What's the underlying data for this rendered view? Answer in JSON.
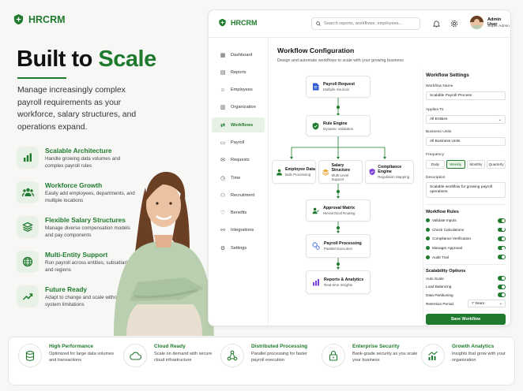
{
  "brand": {
    "name": "HRCRM"
  },
  "hero": {
    "title_part1": "Built to ",
    "title_part2": "Scale",
    "description": "Manage increasingly complex payroll requirements as your workforce, salary structures, and operations expand."
  },
  "features": [
    {
      "icon": "bar-chart-icon",
      "title": "Scalable Architecture",
      "desc": "Handle growing data volumes and complex payroll rules"
    },
    {
      "icon": "users-icon",
      "title": "Workforce Growth",
      "desc": "Easily add employees, departments, and multiple locations"
    },
    {
      "icon": "layers-icon",
      "title": "Flexible Salary Structures",
      "desc": "Manage diverse compensation models and pay components"
    },
    {
      "icon": "globe-icon",
      "title": "Multi-Entity Support",
      "desc": "Run payroll across entities, subsidiaries, and regions"
    },
    {
      "icon": "trend-up-icon",
      "title": "Future Ready",
      "desc": "Adapt to change and scale without system limitations"
    }
  ],
  "app": {
    "logo": "HRCRM",
    "search_placeholder": "Search reports, workflows, employees...",
    "user": {
      "name": "Admin User",
      "role": "Super Admin"
    },
    "nav": [
      {
        "label": "Dashboard",
        "icon": "grid-icon"
      },
      {
        "label": "Reports",
        "icon": "report-icon"
      },
      {
        "label": "Employees",
        "icon": "user-icon"
      },
      {
        "label": "Organization",
        "icon": "building-icon"
      },
      {
        "label": "Workflows",
        "icon": "workflow-icon"
      },
      {
        "label": "Payroll",
        "icon": "wallet-icon"
      },
      {
        "label": "Requests",
        "icon": "request-icon"
      },
      {
        "label": "Time",
        "icon": "clock-icon"
      },
      {
        "label": "Recruitment",
        "icon": "recruit-icon"
      },
      {
        "label": "Benefits",
        "icon": "gift-icon"
      },
      {
        "label": "Integrations",
        "icon": "plug-icon"
      },
      {
        "label": "Settings",
        "icon": "gear-icon"
      }
    ],
    "active_nav": "Workflows",
    "main": {
      "title": "Workflow Configuration",
      "subtitle": "Design and automate workflows to scale with your growing business"
    },
    "workflow": {
      "payroll_request": {
        "title": "Payroll Request",
        "sub": "Multiple Sources"
      },
      "rule_engine": {
        "title": "Rule Engine",
        "sub": "Dynamic Validation"
      },
      "employee_data": {
        "title": "Employee Data",
        "sub": "Bulk Processing"
      },
      "salary_structure": {
        "title": "Salary Structure",
        "sub": "Multi-Level Support"
      },
      "compliance_engine": {
        "title": "Compliance Engine",
        "sub": "Regulation Mapping"
      },
      "approval_matrix": {
        "title": "Approval Matrix",
        "sub": "Hierarchical Routing"
      },
      "payroll_processing": {
        "title": "Payroll Processing",
        "sub": "Parallel Execution"
      },
      "reports_analytics": {
        "title": "Reports & Analytics",
        "sub": "Real-time Insights"
      }
    },
    "settings": {
      "title": "Workflow Settings",
      "name_label": "Workflow Name",
      "name_value": "Scalable Payroll Process",
      "applies_label": "Applies To",
      "applies_value": "All Entities",
      "units_label": "Business Units",
      "units_value": "All Business Units",
      "frequency_label": "Frequency",
      "frequency_options": [
        "Daily",
        "Weekly",
        "Monthly",
        "Quarterly"
      ],
      "frequency_selected": "Weekly",
      "description_label": "Description",
      "description_value": "Scalable workflow for growing payroll operations",
      "rules_title": "Workflow Rules",
      "rules": [
        "Validate Inputs",
        "Check Calculations",
        "Compliance Verification",
        "Manager Approval",
        "Audit Trail"
      ],
      "scal_title": "Scalability Options",
      "scal_options": [
        "Auto Scale",
        "Load Balancing",
        "Data Partitioning"
      ],
      "retention_label": "Retention Period",
      "retention_value": "7 Years",
      "save_label": "Save Workflow"
    }
  },
  "bottom": [
    {
      "icon": "database-icon",
      "title": "High Performance",
      "desc": "Optimized for large data volumes and transactions"
    },
    {
      "icon": "cloud-icon",
      "title": "Cloud Ready",
      "desc": "Scale on demand with secure cloud infrastructure"
    },
    {
      "icon": "share-nodes-icon",
      "title": "Distributed Processing",
      "desc": "Parallel processing for faster payroll execution"
    },
    {
      "icon": "lock-icon",
      "title": "Enterprise Security",
      "desc": "Bank-grade security as you scale your business"
    },
    {
      "icon": "growth-chart-icon",
      "title": "Growth Analytics",
      "desc": "Insights that grow with your organization"
    }
  ],
  "colors": {
    "primary": "#1f7a2e",
    "primary_light": "#e8f1e6",
    "background": "#f7f8f6"
  }
}
